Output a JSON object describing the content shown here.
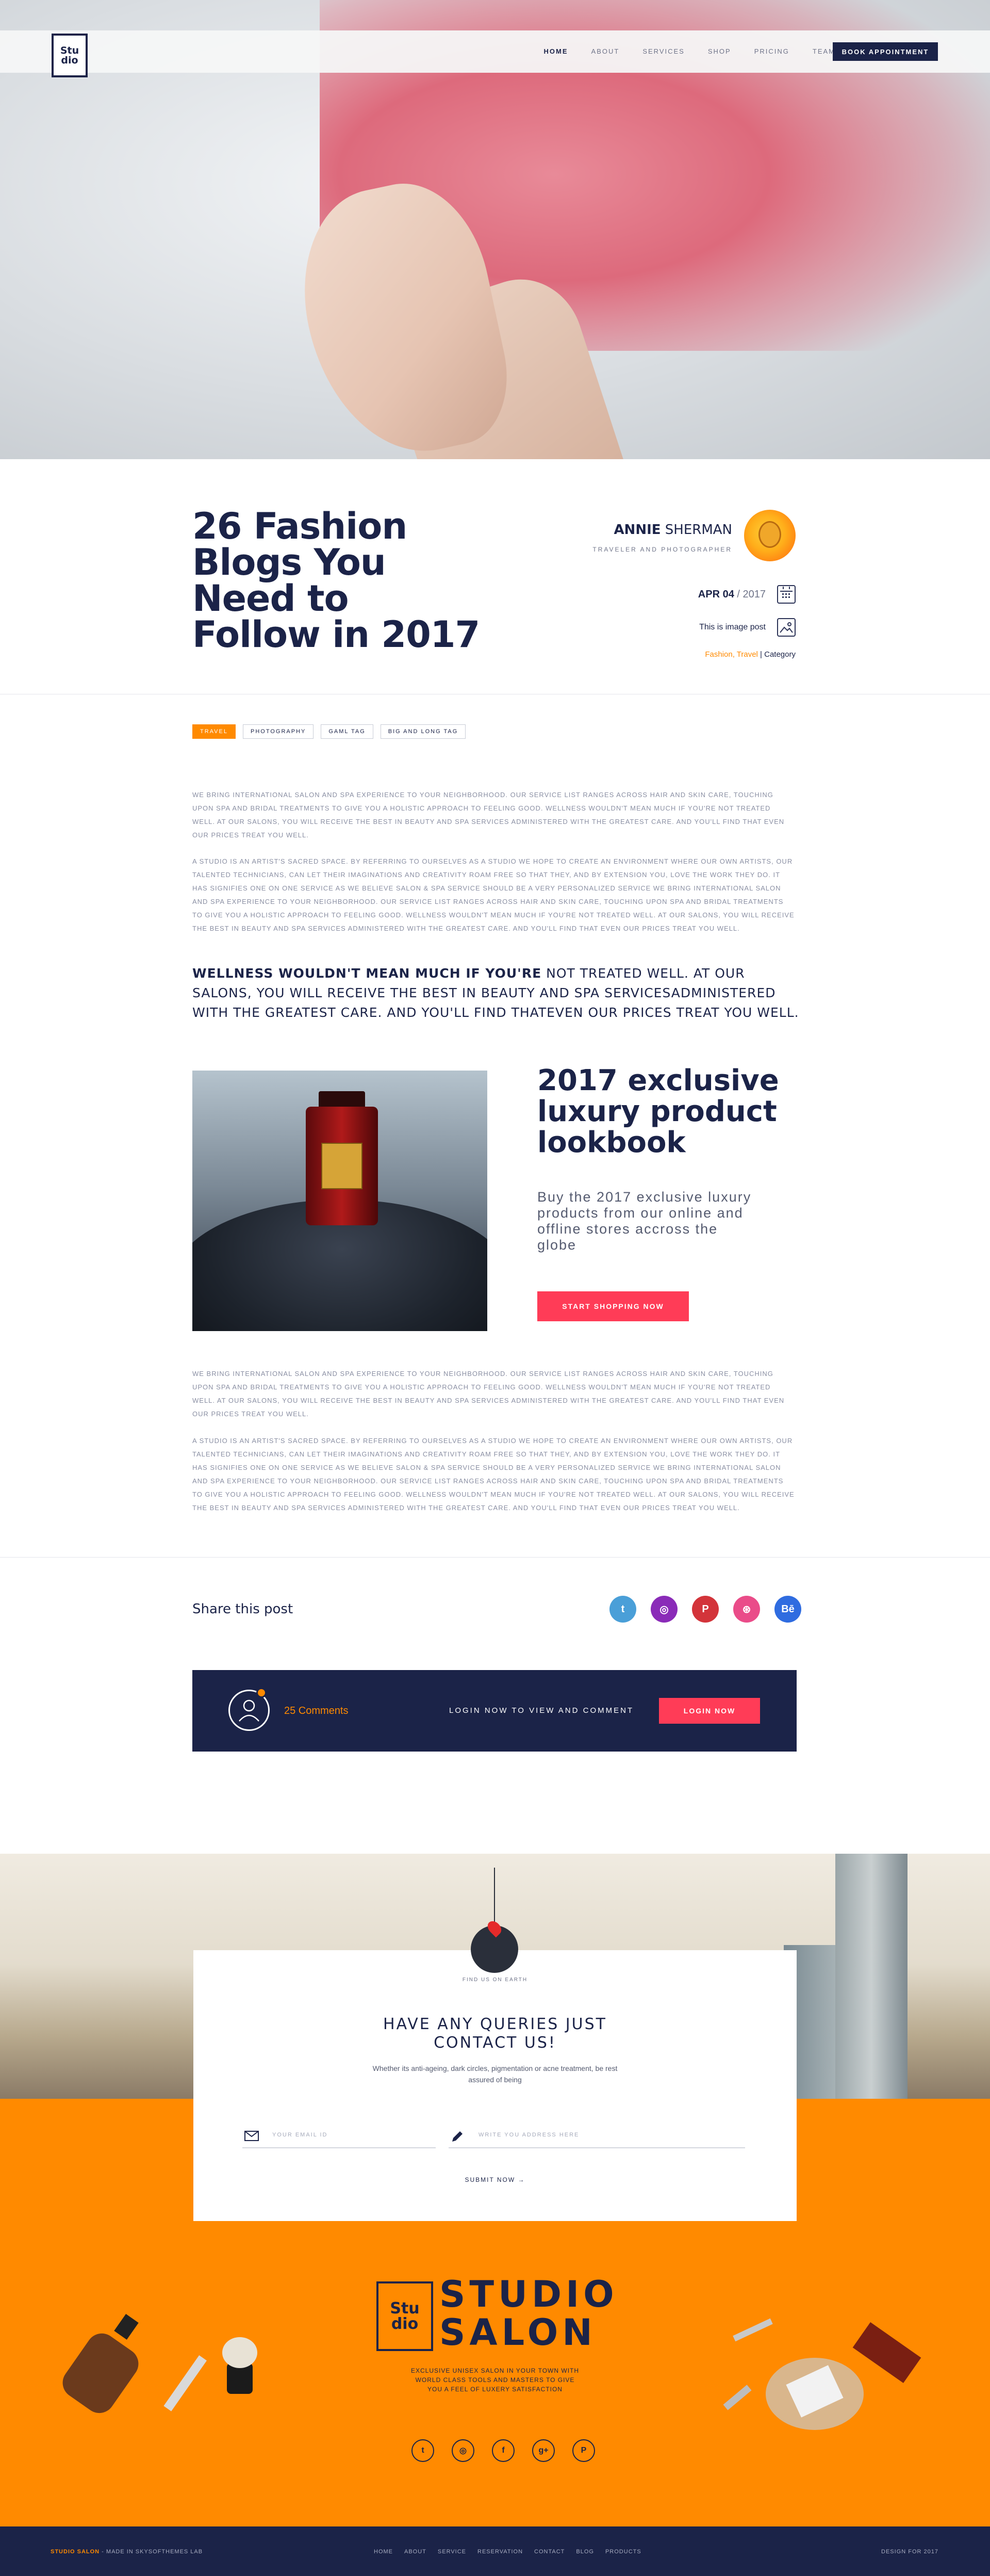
{
  "header": {
    "logo_text": "Stu\ndio",
    "nav": [
      "HOME",
      "ABOUT",
      "SERVICES",
      "SHOP",
      "PRICING",
      "TEAM"
    ],
    "active_nav": "HOME",
    "cta": "BOOK APPOINTMENT"
  },
  "post": {
    "title": "26 Fashion Blogs You Need to Follow in 2017",
    "author_first": "ANNIE",
    "author_last": " SHERMAN",
    "author_role": "TRAVELER AND PHOTOGRAPHER",
    "date_day": "APR 04",
    "date_sep": " / ",
    "date_year": "2017",
    "post_type": "This is image post",
    "categories_highlight": "Fashion, Travel",
    "categories_rest": " | Category",
    "tags": [
      "TRAVEL",
      "PHOTOGRAPHY",
      "GAML TAG",
      "BIG AND LONG TAG"
    ],
    "para1": "We bring international salon and spa experience to your neighborhood. Our service list ranges across hair and skin care, touching upon spa and bridal treatments to give you a holistic approach to feeling good. Wellness wouldn't mean much if you're not treated well. At our salons, you will receive the best in beauty and spa services administered with the greatest care. And you'll find that even our prices treat you well.",
    "para2": "A studio is an artist's sacred space. By referring to ourselves as a studio we hope to create an environment where our own artists, our talented technicians, can let their imaginations and creativity roam free so that they, and by extension you, love the work they do. It has signifies one on one service as we believe salon & spa service should be a very personalized service we bring international salon and spa experience to your neighborhood. Our service list ranges across hair and skin care, touching upon spa and bridal treatments to give you a holistic approach to feeling good. Wellness wouldn't mean much if you're not treated well. At our salons, you will receive the best in beauty and spa services administered with the greatest care. And you'll find that even our prices treat you well.",
    "quote_bold": "WELLNESS WOULDN'T MEAN MUCH IF YOU'RE",
    "quote_rest": " NOT TREATED WELL. AT OUR SALONS, YOU WILL RECEIVE THE BEST IN BEAUTY AND SPA SERVICESADMINISTERED WITH THE GREATEST CARE. AND YOU'LL FIND THATEVEN OUR PRICES TREAT YOU WELL.",
    "product_title": "2017 exclusive luxury product lookbook",
    "product_text": "Buy the 2017 exclusive luxury products from our online and offline stores accross the globe",
    "product_cta": "START SHOPPING NOW",
    "para3": "We bring international salon and spa experience to your neighborhood. Our service list ranges across hair and skin care, touching upon spa and bridal treatments to give you a holistic approach to feeling good. Wellness wouldn't mean much if you're not treated well. At our salons, you will receive the best in beauty and spa services administered with the greatest care. And you'll find that even our prices treat you well.",
    "para4": "A studio is an artist's sacred space. By referring to ourselves as a studio we hope to create an environment where our own artists, our talented technicians, can let their imaginations and creativity roam free so that they, and by extension you, love the work they do. It has signifies one on one service as we believe salon & spa service should be a very personalized service we bring international salon and spa experience to your neighborhood. Our service list ranges across hair and skin care, touching upon spa and bridal treatments to give you a holistic approach to feeling good. Wellness wouldn't mean much if you're not treated well. At our salons, you will receive the best in beauty and spa services administered with the greatest care. And you'll find that even our prices treat you well."
  },
  "share": {
    "label": "Share this post",
    "icons": [
      {
        "name": "twitter-icon",
        "glyph": "t",
        "color": "#4a9fd8"
      },
      {
        "name": "instagram-icon",
        "glyph": "◎",
        "color": "#8a2bb8"
      },
      {
        "name": "pinterest-icon",
        "glyph": "P",
        "color": "#d3343a"
      },
      {
        "name": "dribbble-icon",
        "glyph": "⊛",
        "color": "#ea4c89"
      },
      {
        "name": "behance-icon",
        "glyph": "Bē",
        "color": "#2f6ce0"
      }
    ]
  },
  "comments": {
    "count": "25 Comments",
    "login_text": "LOGIN NOW TO VIEW AND COMMENT",
    "login_btn": "LOGIN NOW"
  },
  "contact": {
    "find_us": "FIND US ON EARTH",
    "heading": "HAVE ANY QUERIES JUST CONTACT US!",
    "sub": "Whether its anti-ageing, dark circles, pigmentation or acne treatment, be rest assured of being",
    "email_placeholder": "YOUR EMAIL ID",
    "address_placeholder": "WRITE YOU ADDRESS HERE",
    "submit": "SUBMIT NOW →"
  },
  "footer": {
    "logo_text": "Stu\ndio",
    "brand": "STUDIO\nSALON",
    "tagline": "EXCLUSIVE UNISEX SALON IN YOUR TOWN WITH WORLD CLASS TOOLS AND MASTERS TO GIVE YOU A FEEL OF LUXERY SATISFACTION",
    "socials": [
      "t",
      "◎",
      "f",
      "g+",
      "P"
    ],
    "bottom_left_hl": "STUDIO SALON",
    "bottom_left_rest": " - MADE IN SKYSOFTHEMES LAB",
    "bottom_nav": [
      "HOME",
      "ABOUT",
      "SERVICE",
      "RESERVATION",
      "CONTACT",
      "BLOG",
      "PRODUCTS"
    ],
    "bottom_right": "DESIGN FOR 2017"
  },
  "colors": {
    "navy": "#1b2348",
    "orange": "#ff8a00",
    "red": "#ff3c57"
  }
}
